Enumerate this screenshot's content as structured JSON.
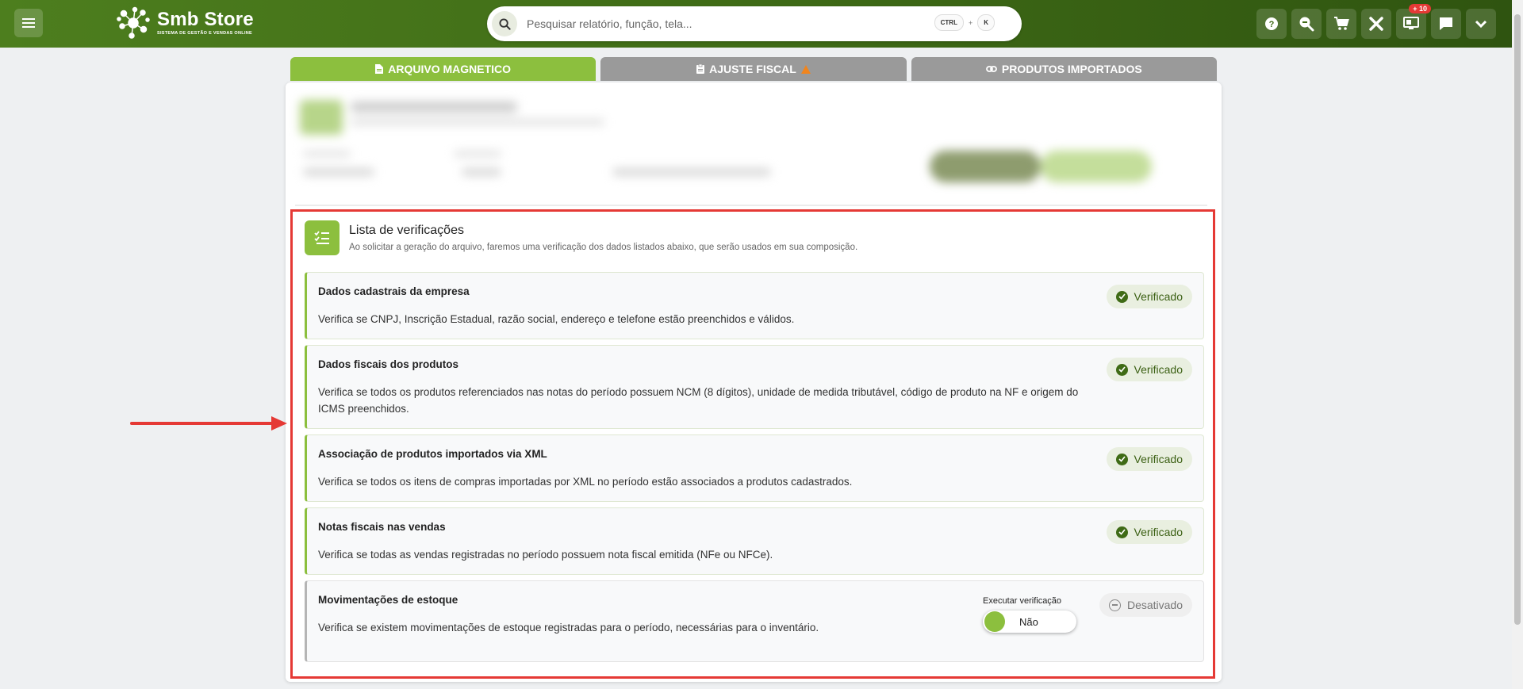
{
  "topbar": {
    "brand_name": "Smb Store",
    "brand_tagline": "SISTEMA DE GESTÃO E VENDAS ONLINE",
    "search_placeholder": "Pesquisar relatório, função, tela...",
    "shortcut_key1": "CTRL",
    "shortcut_plus": "+",
    "shortcut_key2": "K",
    "notification_badge": "+ 10",
    "icons": [
      "help-icon",
      "zoom-icon",
      "cart-icon",
      "tools-icon",
      "monitor-icon",
      "chat-icon",
      "chevron-down-icon"
    ]
  },
  "tabs": [
    {
      "label": "ARQUIVO MAGNETICO",
      "active": true
    },
    {
      "label": "AJUSTE FISCAL",
      "active": false
    },
    {
      "label": "PRODUTOS IMPORTADOS",
      "active": false
    }
  ],
  "checklist": {
    "title": "Lista de verificações",
    "subtitle": "Ao solicitar a geração do arquivo, faremos uma verificação dos dados listados abaixo, que serão usados em sua composição.",
    "items": [
      {
        "title": "Dados cadastrais da empresa",
        "description": "Verifica se CNPJ, Inscrição Estadual, razão social, endereço e telefone estão preenchidos e válidos.",
        "status": "Verificado"
      },
      {
        "title": "Dados fiscais dos produtos",
        "description": "Verifica se todos os produtos referenciados nas notas do período possuem NCM (8 dígitos), unidade de medida tributável, código de produto na NF e origem do ICMS preenchidos.",
        "status": "Verificado"
      },
      {
        "title": "Associação de produtos importados via XML",
        "description": "Verifica se todos os itens de compras importadas por XML no período estão associados a produtos cadastrados.",
        "status": "Verificado"
      },
      {
        "title": "Notas fiscais nas vendas",
        "description": "Verifica se todas as vendas registradas no período possuem nota fiscal emitida (NFe ou NFCe).",
        "status": "Verificado"
      },
      {
        "title": "Movimentações de estoque",
        "description": "Verifica se existem movimentações de estoque registradas para o período, necessárias para o inventário.",
        "status": "Desativado",
        "exec_label": "Executar verificação",
        "toggle_label": "Não"
      }
    ]
  },
  "colors": {
    "brand_green": "#8cbf3e",
    "topbar_dark": "#3f6b16",
    "highlight_red": "#e53935",
    "warning_orange": "#f0851e"
  }
}
